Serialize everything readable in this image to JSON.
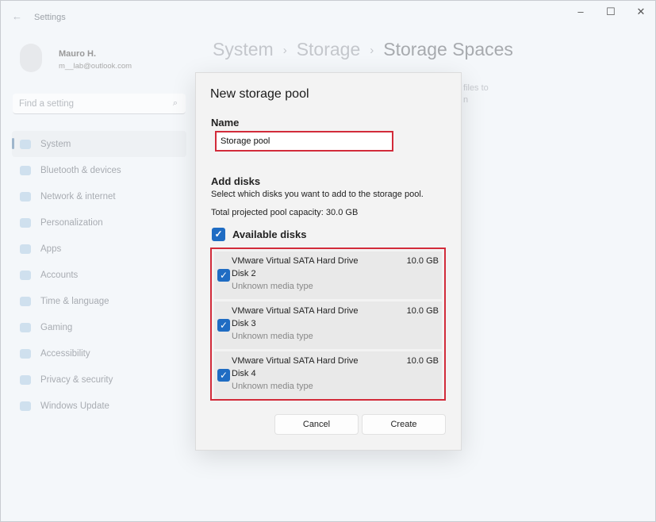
{
  "app": {
    "title": "Settings",
    "controls": [
      "–",
      "☐",
      "✕"
    ]
  },
  "user": {
    "name": "Mauro H.",
    "email": "m__lab@outlook.com"
  },
  "search": {
    "placeholder": "Find a setting"
  },
  "nav": [
    {
      "label": "System"
    },
    {
      "label": "Bluetooth & devices"
    },
    {
      "label": "Network & internet"
    },
    {
      "label": "Personalization"
    },
    {
      "label": "Apps"
    },
    {
      "label": "Accounts"
    },
    {
      "label": "Time & language"
    },
    {
      "label": "Gaming"
    },
    {
      "label": "Accessibility"
    },
    {
      "label": "Privacy & security"
    },
    {
      "label": "Windows Update"
    }
  ],
  "breadcrumb": [
    "System",
    "Storage",
    "Storage Spaces"
  ],
  "background_text": [
    "files to",
    "n"
  ],
  "dialog": {
    "title": "New storage pool",
    "name_label": "Name",
    "name_value": "Storage pool",
    "add_disks": "Add disks",
    "add_desc": "Select which disks you want to add to the storage pool.",
    "capacity": "Total projected pool capacity: 30.0 GB",
    "available": "Available disks",
    "disks": [
      {
        "model": "VMware Virtual SATA Hard Drive",
        "name": "Disk 2",
        "type": "Unknown media type",
        "size": "10.0 GB",
        "checked": true
      },
      {
        "model": "VMware Virtual SATA Hard Drive",
        "name": "Disk 3",
        "type": "Unknown media type",
        "size": "10.0 GB",
        "checked": true
      },
      {
        "model": "VMware Virtual SATA Hard Drive",
        "name": "Disk 4",
        "type": "Unknown media type",
        "size": "10.0 GB",
        "checked": true
      }
    ],
    "cancel": "Cancel",
    "create": "Create"
  },
  "colors": {
    "accent": "#1f6cc3",
    "highlight": "#d22b3a"
  }
}
